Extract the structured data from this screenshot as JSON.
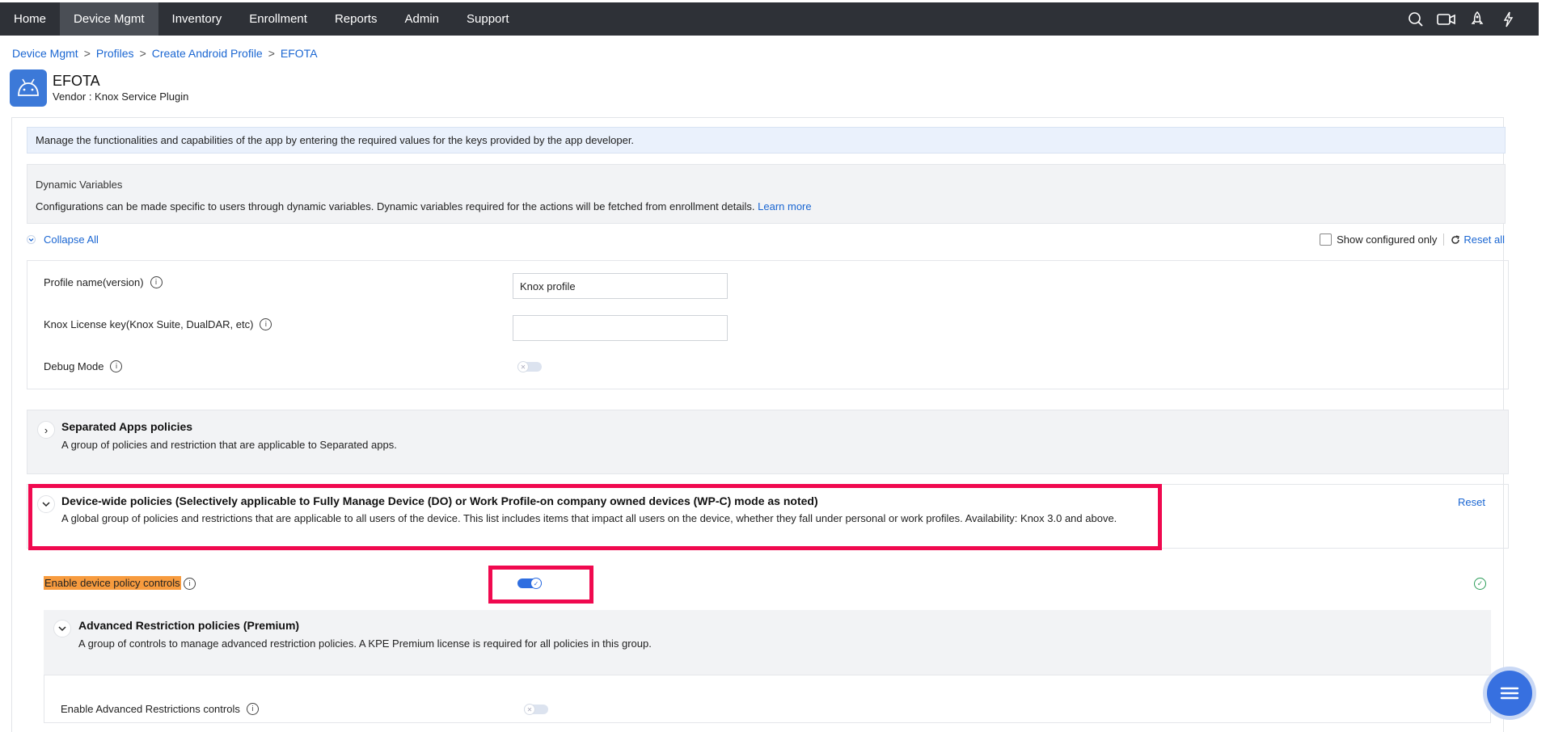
{
  "nav": {
    "items": [
      "Home",
      "Device Mgmt",
      "Inventory",
      "Enrollment",
      "Reports",
      "Admin",
      "Support"
    ],
    "active": "Device Mgmt",
    "icons": [
      "search-icon",
      "video-icon",
      "rocket-icon",
      "lightning-icon"
    ]
  },
  "breadcrumb": [
    "Device Mgmt",
    "Profiles",
    "Create Android Profile",
    "EFOTA"
  ],
  "app": {
    "icon": "android-icon",
    "name": "EFOTA",
    "vendor": "Vendor : Knox Service Plugin"
  },
  "banner": "Manage the functionalities and capabilities of the app by entering the required values for the keys provided by the app developer.",
  "dynamic": {
    "title": "Dynamic Variables",
    "text": "Configurations can be made specific to users through dynamic variables. Dynamic variables required for the actions will be fetched from enrollment details.",
    "link": "Learn more"
  },
  "toolbar": {
    "collapse_all": "Collapse All",
    "show_configured": "Show configured only",
    "show_configured_checked": false,
    "reset_all": "Reset all"
  },
  "form": {
    "profile_label": "Profile name(version)",
    "profile_value": "Knox profile",
    "license_label": "Knox License key(Knox Suite, DualDAR, etc)",
    "license_value": "",
    "debug_label": "Debug Mode",
    "debug_on": false
  },
  "sections": {
    "separated": {
      "title": "Separated Apps policies",
      "desc": "A group of policies and restriction that are applicable to Separated apps.",
      "expanded": false
    },
    "device_wide": {
      "title": "Device-wide policies (Selectively applicable to Fully Manage Device (DO) or Work Profile-on company owned devices (WP-C) mode as noted)",
      "desc": "A global group of policies and restrictions that are applicable to all users of the device. This list includes items that impact all users on the device, whether they fall under personal or work profiles. Availability: Knox 3.0 and above.",
      "reset": "Reset",
      "expanded": true
    },
    "enable_device_policy": {
      "label": "Enable device policy controls",
      "on": true
    },
    "advanced": {
      "title": "Advanced Restriction policies (Premium)",
      "desc": "A group of controls to manage advanced restriction policies. A KPE Premium license is required for all policies in this group.",
      "enable_label": "Enable Advanced Restrictions controls",
      "enable_on": false
    }
  },
  "colors": {
    "nav_bg": "#2e3137",
    "accent": "#1a66d2",
    "highlight_border": "#f0094f",
    "highlight_label": "#f79b3e"
  }
}
